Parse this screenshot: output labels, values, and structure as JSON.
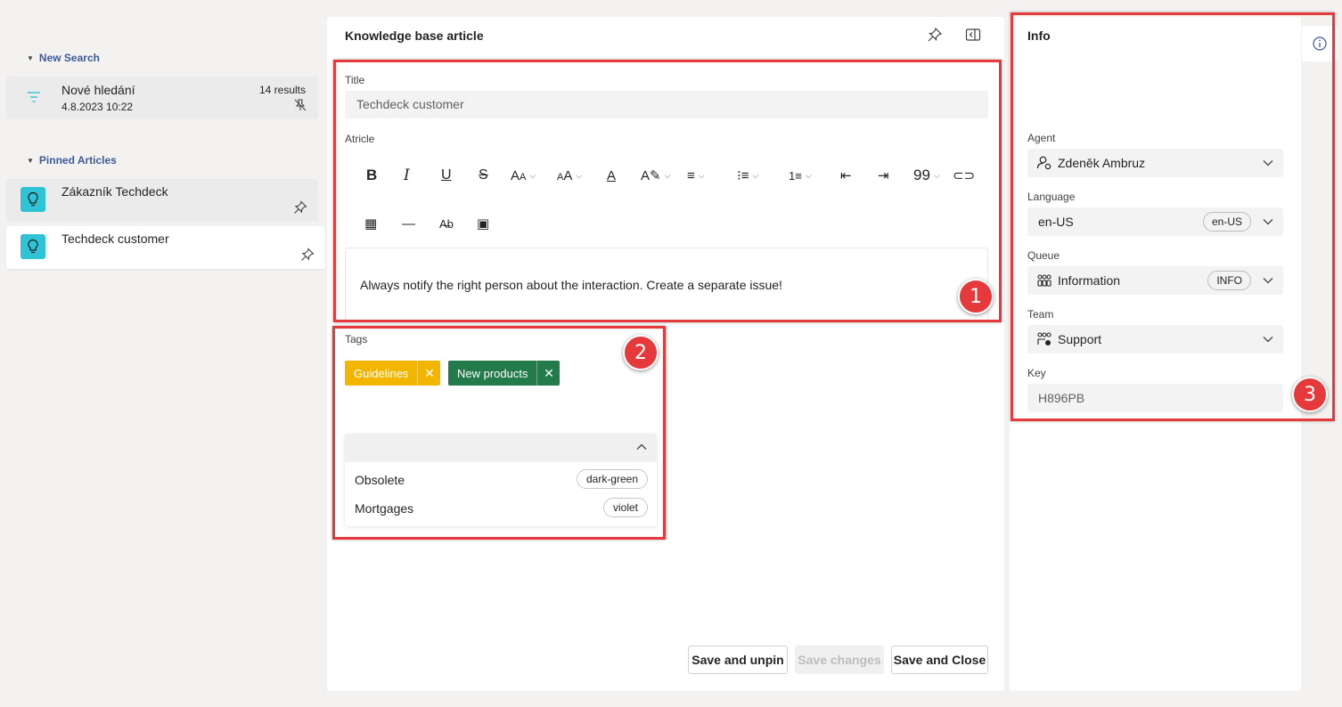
{
  "sidebar": {
    "new_search_heading": "New Search",
    "search_item": {
      "name": "Nové hledání",
      "date": "4.8.2023 10:22",
      "count": "14 results"
    },
    "pinned_heading": "Pinned Articles",
    "pinned": [
      {
        "name": "Zákazník Techdeck"
      },
      {
        "name": "Techdeck customer"
      }
    ]
  },
  "article": {
    "header": "Knowledge base article",
    "title_label": "Title",
    "title_value": "Techdeck customer",
    "article_label": "Atricle",
    "body_text": "Always notify the right person about the interaction. Create a separate issue!",
    "tags_label": "Tags",
    "tags": [
      {
        "label": "Guidelines",
        "color": "#f2b600"
      },
      {
        "label": "New products",
        "color": "#237b4b"
      }
    ],
    "tag_options": [
      {
        "name": "Obsolete",
        "color_name": "dark-green"
      },
      {
        "name": "Mortgages",
        "color_name": "violet"
      }
    ],
    "buttons": {
      "save_unpin": "Save and unpin",
      "save_changes": "Save changes",
      "save_close": "Save and Close"
    }
  },
  "info": {
    "header": "Info",
    "agent_label": "Agent",
    "agent_value": "Zdeněk Ambruz",
    "language_label": "Language",
    "language_value": "en-US",
    "language_code": "en-US",
    "queue_label": "Queue",
    "queue_value": "Information",
    "queue_code": "INFO",
    "team_label": "Team",
    "team_value": "Support",
    "key_label": "Key",
    "key_value": "H896PB"
  },
  "annotations": [
    "1",
    "2",
    "3"
  ],
  "colors": {
    "annotation_red": "#e5393b",
    "link_blue": "#3d5a99",
    "bulb_cyan": "#2ec4d6"
  }
}
